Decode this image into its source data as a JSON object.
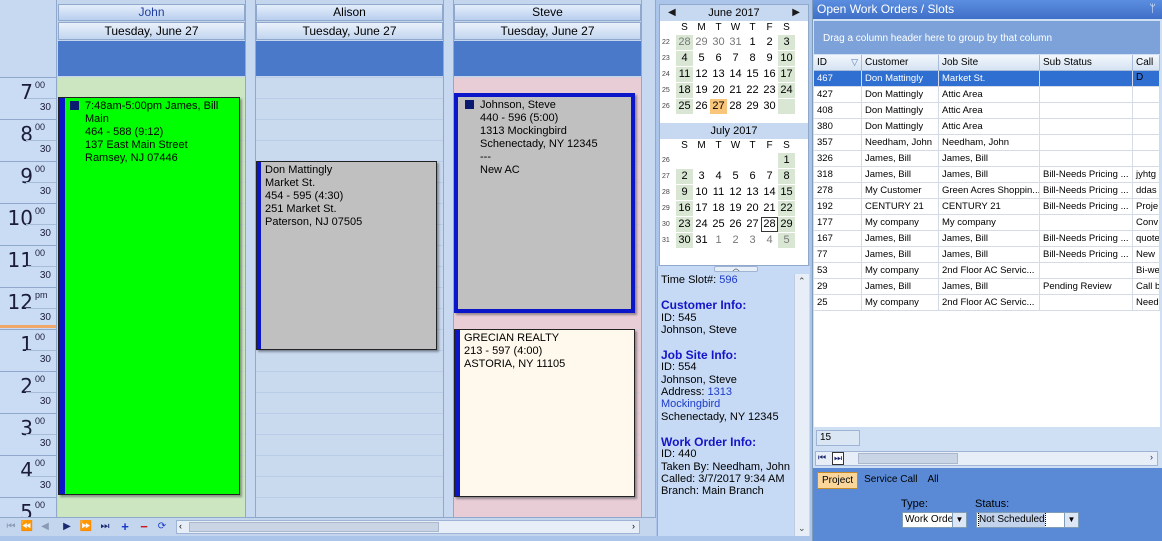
{
  "scheduler": {
    "columns": [
      {
        "name": "John",
        "date": "Tuesday, June 27"
      },
      {
        "name": "Alison",
        "date": "Tuesday, June 27"
      },
      {
        "name": "Steve",
        "date": "Tuesday, June 27"
      }
    ],
    "hours": [
      {
        "h": "7",
        "m": "00",
        "half": "30"
      },
      {
        "h": "8",
        "m": "00",
        "half": "30"
      },
      {
        "h": "9",
        "m": "00",
        "half": "30"
      },
      {
        "h": "10",
        "m": "00",
        "half": "30"
      },
      {
        "h": "11",
        "m": "00",
        "half": "30"
      },
      {
        "h": "12",
        "m": "pm",
        "half": "30"
      },
      {
        "h": "1",
        "m": "00",
        "half": "30"
      },
      {
        "h": "2",
        "m": "00",
        "half": "30"
      },
      {
        "h": "3",
        "m": "00",
        "half": "30"
      },
      {
        "h": "4",
        "m": "00",
        "half": "30"
      },
      {
        "h": "5",
        "m": "00",
        "half": ""
      }
    ],
    "appointments": {
      "john": [
        "7:48am-5:00pm James, Bill",
        "Main",
        "464 - 588  (9:12)",
        "137 East Main Street",
        "Ramsey, NJ 07446"
      ],
      "alison": [
        "Don Mattingly",
        "Market St.",
        "454 - 595  (4:30)",
        "251 Market St.",
        "Paterson, NJ 07505"
      ],
      "steve1": [
        "Johnson, Steve",
        "440 - 596  (5:00)",
        "1313 Mockingbird",
        "Schenectady, NY 12345",
        "---",
        "New AC"
      ],
      "steve2": [
        "GRECIAN REALTY",
        "213 - 597  (4:00)",
        "ASTORIA, NY 11105"
      ]
    },
    "colors": {
      "john": "#00ff00",
      "alison": "#c0c0c0",
      "steve1": "#c0c0c0",
      "steve2": "#fff8ec"
    }
  },
  "calendar": {
    "june": {
      "title": "June 2017",
      "dow": [
        "S",
        "M",
        "T",
        "W",
        "T",
        "F",
        "S"
      ],
      "weeks": [
        {
          "wk": "22",
          "days": [
            "28",
            "29",
            "30",
            "31",
            "1",
            "2",
            "3"
          ]
        },
        {
          "wk": "23",
          "days": [
            "4",
            "5",
            "6",
            "7",
            "8",
            "9",
            "10"
          ]
        },
        {
          "wk": "24",
          "days": [
            "11",
            "12",
            "13",
            "14",
            "15",
            "16",
            "17"
          ]
        },
        {
          "wk": "25",
          "days": [
            "18",
            "19",
            "20",
            "21",
            "22",
            "23",
            "24"
          ]
        },
        {
          "wk": "26",
          "days": [
            "25",
            "26",
            "27",
            "28",
            "29",
            "30",
            ""
          ]
        }
      ]
    },
    "july": {
      "title": "July 2017",
      "dow": [
        "S",
        "M",
        "T",
        "W",
        "T",
        "F",
        "S"
      ],
      "weeks": [
        {
          "wk": "26",
          "days": [
            "",
            "",
            "",
            "",
            "",
            "",
            "1"
          ]
        },
        {
          "wk": "27",
          "days": [
            "2",
            "3",
            "4",
            "5",
            "6",
            "7",
            "8"
          ]
        },
        {
          "wk": "28",
          "days": [
            "9",
            "10",
            "11",
            "12",
            "13",
            "14",
            "15"
          ]
        },
        {
          "wk": "29",
          "days": [
            "16",
            "17",
            "18",
            "19",
            "20",
            "21",
            "22"
          ]
        },
        {
          "wk": "30",
          "days": [
            "23",
            "24",
            "25",
            "26",
            "27",
            "28",
            "29"
          ]
        },
        {
          "wk": "31",
          "days": [
            "30",
            "31",
            "1",
            "2",
            "3",
            "4",
            "5"
          ]
        }
      ]
    }
  },
  "info": {
    "timeslot_label": "Time Slot#:",
    "timeslot_value": "596",
    "customer_header": "Customer Info:",
    "customer_id": "ID: 545",
    "customer_name": "Johnson, Steve",
    "jobsite_header": "Job Site Info:",
    "jobsite_id": "ID: 554",
    "jobsite_name": "Johnson, Steve",
    "address_label": "Address:",
    "address_value": "1313 Mockingbird",
    "address_city": "Schenectady, NY 12345",
    "wo_header": "Work Order Info:",
    "wo_id": "ID: 440",
    "taken_by": "Taken By: Needham, John",
    "called": "Called: 3/7/2017 9:34 AM",
    "branch": "Branch: Main Branch"
  },
  "workorders": {
    "title": "Open Work Orders / Slots",
    "pin": "ᛘ",
    "group_hint": "Drag a column header here to group by that column",
    "headers": [
      "ID",
      "Customer",
      "Job Site",
      "Sub Status",
      "Call D"
    ],
    "rows": [
      [
        "467",
        "Don Mattingly",
        "Market St.",
        "",
        ""
      ],
      [
        "427",
        "Don Mattingly",
        "Attic Area",
        "",
        ""
      ],
      [
        "408",
        "Don Mattingly",
        "Attic Area",
        "",
        ""
      ],
      [
        "380",
        "Don Mattingly",
        "Attic Area",
        "",
        ""
      ],
      [
        "357",
        "Needham, John",
        "Needham, John",
        "",
        ""
      ],
      [
        "326",
        "James, Bill",
        "James, Bill",
        "",
        ""
      ],
      [
        "318",
        "James, Bill",
        "James, Bill",
        "Bill-Needs Pricing ...",
        "jyhtg"
      ],
      [
        "278",
        "My Customer",
        "Green Acres Shoppin...",
        "Bill-Needs Pricing ...",
        "ddas"
      ],
      [
        "192",
        "CENTURY 21",
        "CENTURY 21",
        "Bill-Needs Pricing ...",
        "Proje"
      ],
      [
        "177",
        "My company",
        "My company",
        "",
        "Conv"
      ],
      [
        "167",
        "James, Bill",
        "James, Bill",
        "Bill-Needs Pricing ...",
        "quote"
      ],
      [
        "77",
        "James, Bill",
        "James, Bill",
        "Bill-Needs Pricing ...",
        "New"
      ],
      [
        "53",
        "My company",
        "2nd Floor AC Servic...",
        "",
        "Bi-we"
      ],
      [
        "29",
        "James, Bill",
        "James, Bill",
        "Pending Review",
        "Call b"
      ],
      [
        "25",
        "My company",
        "2nd Floor AC Servic...",
        "",
        "Need"
      ]
    ],
    "count": "15",
    "tabs": [
      "Project",
      "Service Call",
      "All"
    ],
    "type_label": "Type:",
    "type_value": "Work Orde",
    "status_label": "Status:",
    "status_value": "Not Scheduled"
  }
}
